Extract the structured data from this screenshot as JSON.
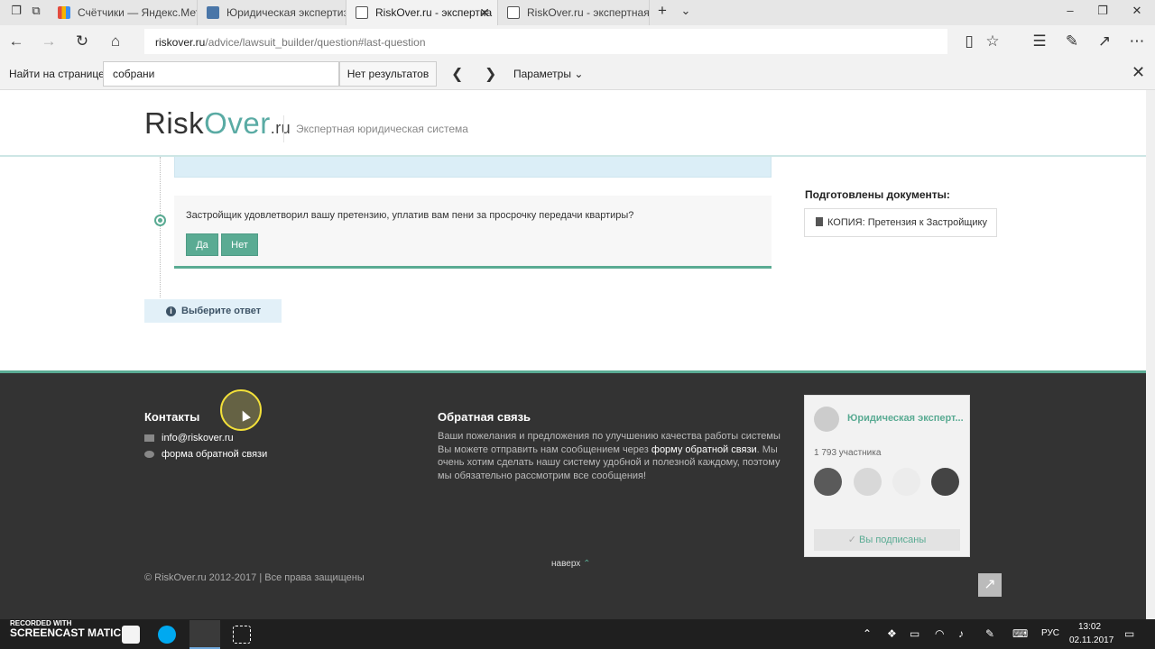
{
  "browser": {
    "tabs": [
      {
        "label": "Счётчики — Яндекс.Метри",
        "fav_color": "#e34b3e"
      },
      {
        "label": "Юридическая экспертиза",
        "fav_color": "#4a76a8"
      },
      {
        "label": "RiskOver.ru - экспертна",
        "fav_color": "#555555"
      },
      {
        "label": "RiskOver.ru - экспертная ю",
        "fav_color": "#555555"
      }
    ],
    "url_host": "riskover.ru",
    "url_path": "/advice/lawsuit_builder/question#last-question",
    "icons": [
      "back-icon",
      "forward-icon",
      "refresh-icon",
      "home-icon",
      "reading-view-icon",
      "favorite-star-icon",
      "favorites-hub-icon",
      "pen-icon",
      "share-icon",
      "more-icon"
    ]
  },
  "findbar": {
    "label": "Найти на странице",
    "query": "собрани",
    "results": "Нет результатов",
    "options": "Параметры"
  },
  "site": {
    "logo_risk": "Risk",
    "logo_over": "Over",
    "logo_ru": ".ru",
    "tagline": "Экспертная юридическая система"
  },
  "question": {
    "text": "Застройщик удовлетворил вашу претензию, уплатив вам пени за просрочку передачи квартиры?",
    "yes_label": "Да",
    "no_label": "Нет"
  },
  "hint": {
    "text": "Выберите ответ"
  },
  "documents": {
    "title": "Подготовлены документы:",
    "items": [
      "КОПИЯ: Претензия к Застройщику"
    ]
  },
  "footer": {
    "contacts_title": "Контакты",
    "email": "info@riskover.ru",
    "feedback_link": "форма обратной связи",
    "feedback_title": "Обратная связь",
    "feedback_text_1": "Ваши пожелания и предложения по улучшению качества работы системы Вы можете отправить нам сообщением через ",
    "feedback_text_link": "форму обратной связи",
    "feedback_text_2": ". Мы очень хотим сделать нашу систему удобной и полезной каждому, поэтому мы обязательно рассмотрим все сообщения!",
    "to_top": "наверх",
    "copyright": "© RiskOver.ru 2012-2017 | Все права защищены"
  },
  "vk_widget": {
    "group_name": "Юридическая эксперт...",
    "members": "1 793 участника",
    "subscribed": "Вы подписаны"
  },
  "taskbar": {
    "recorded_with": "RECORDED WITH",
    "brand": "SCREENCAST  MATIC",
    "lang": "РУС",
    "time": "13:02",
    "date": "02.11.2017"
  }
}
